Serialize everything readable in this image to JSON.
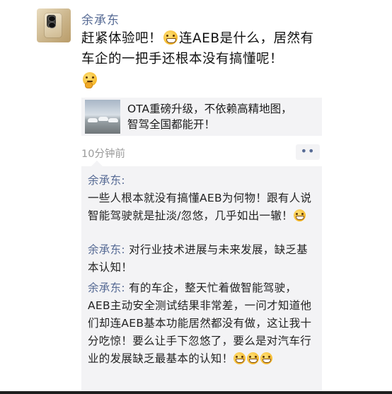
{
  "post": {
    "author": "余承东",
    "text_part1": "赶紧体验吧！",
    "text_part2": "连AEB是什么，居然有车企的一把手还根本没有搞懂呢！",
    "emoji_1": "grin-emoji",
    "emoji_2": "thinking-emoji"
  },
  "link": {
    "line1": "OTA重磅升级，不依赖高精地图，",
    "line2": "智驾全国都能开！"
  },
  "meta": {
    "time": "10分钟前",
    "more_label": "••"
  },
  "comments": [
    {
      "author": "余承东:",
      "text": "一些人根本就没有搞懂AEB为何物！跟有人说智能驾驶就是扯淡/忽悠，几乎如出一辙！"
    },
    {
      "author": "余承东:",
      "text": "对行业技术进展与未来发展，缺乏基本认知！"
    },
    {
      "author": "余承东:",
      "text": "有的车企，整天忙着做智能驾驶，AEB主动安全测试结果非常差，一问才知道他们却连AEB基本功能居然都没有做，这让我十分吃惊！要么让手下忽悠了，要么是对汽车行业的发展缺乏最基本的认知！"
    }
  ],
  "colors": {
    "name_link": "#576b95",
    "card_bg": "#f3f3f5",
    "time_gray": "#9a9a9a"
  }
}
